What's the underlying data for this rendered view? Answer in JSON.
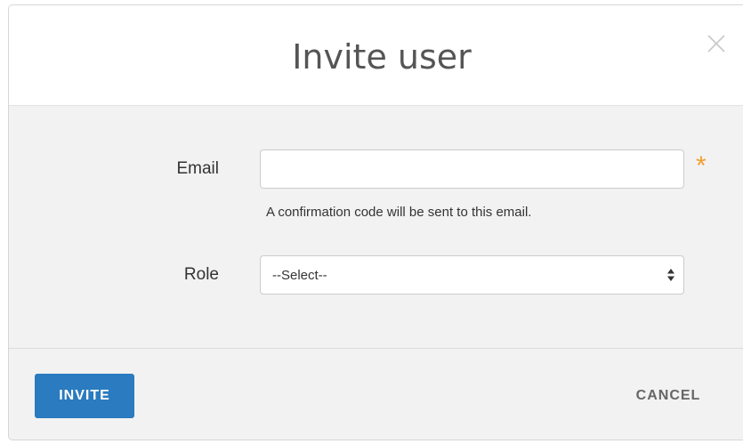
{
  "dialog": {
    "title": "Invite user",
    "close_icon": "close-icon"
  },
  "form": {
    "email": {
      "label": "Email",
      "value": "",
      "placeholder": "",
      "required_marker": "*",
      "help_text": "A confirmation code will be sent to this email."
    },
    "role": {
      "label": "Role",
      "selected": "--Select--"
    }
  },
  "footer": {
    "invite_label": "INVITE",
    "cancel_label": "CANCEL"
  },
  "colors": {
    "primary_button": "#2a7bbf",
    "required_star": "#f0a030",
    "body_background": "#f2f2f2"
  }
}
